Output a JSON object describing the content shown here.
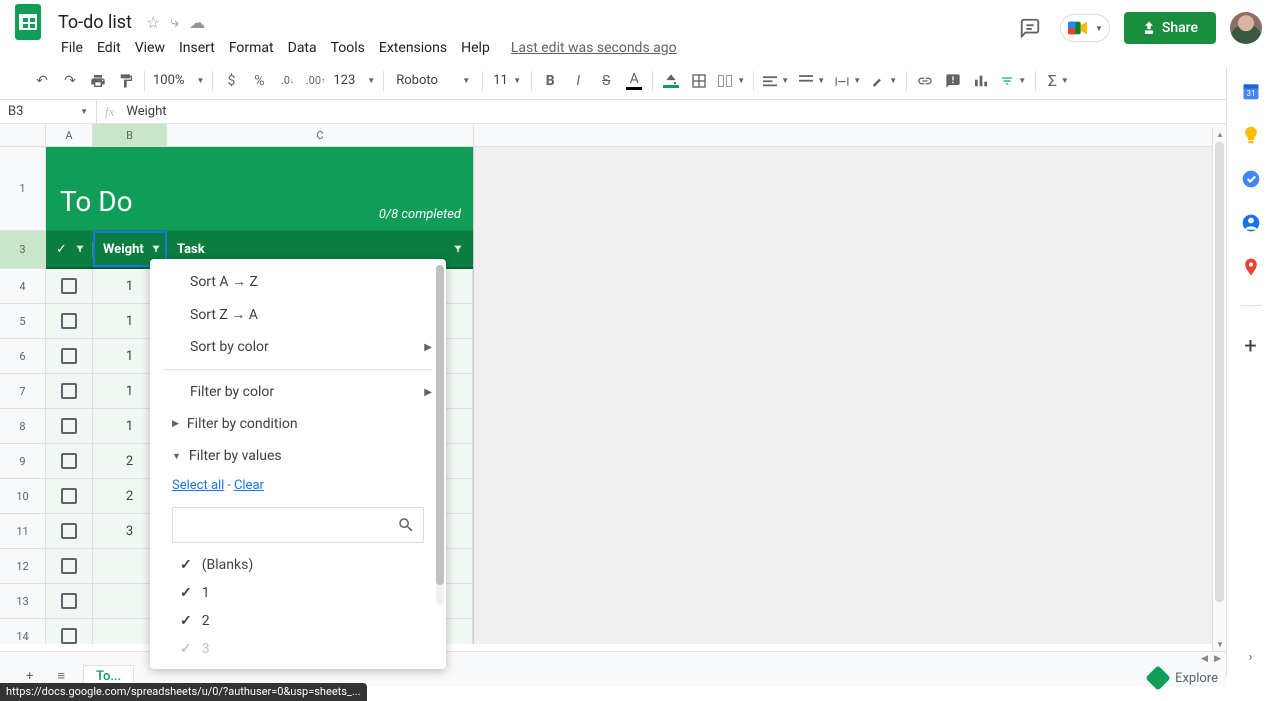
{
  "doc": {
    "title": "To-do list"
  },
  "menu": {
    "file": "File",
    "edit": "Edit",
    "view": "View",
    "insert": "Insert",
    "format": "Format",
    "data": "Data",
    "tools": "Tools",
    "extensions": "Extensions",
    "help": "Help",
    "last_edit": "Last edit was seconds ago"
  },
  "header": {
    "share": "Share"
  },
  "toolbar": {
    "zoom": "100%",
    "font": "Roboto",
    "size": "11",
    "number_format": "123"
  },
  "formula": {
    "name_box": "B3",
    "value": "Weight"
  },
  "columns": {
    "A": "A",
    "B": "B",
    "C": "C"
  },
  "sheet_title": {
    "main": "To Do",
    "completed": "0/8 completed"
  },
  "col_headers": {
    "weight": "Weight",
    "task": "Task"
  },
  "rows": [
    {
      "n": "1"
    },
    {
      "n": "3"
    },
    {
      "n": "4",
      "w": "1"
    },
    {
      "n": "5",
      "w": "1"
    },
    {
      "n": "6",
      "w": "1"
    },
    {
      "n": "7",
      "w": "1"
    },
    {
      "n": "8",
      "w": "1"
    },
    {
      "n": "9",
      "w": "2"
    },
    {
      "n": "10",
      "w": "2"
    },
    {
      "n": "11",
      "w": "3"
    },
    {
      "n": "12"
    },
    {
      "n": "13"
    },
    {
      "n": "14"
    }
  ],
  "filter_popup": {
    "sort_az": "Sort A → Z",
    "sort_za": "Sort Z → A",
    "sort_color": "Sort by color",
    "filter_color": "Filter by color",
    "filter_condition": "Filter by condition",
    "filter_values": "Filter by values",
    "select_all": "Select all",
    "clear": "Clear",
    "values": [
      "(Blanks)",
      "1",
      "2",
      "3"
    ]
  },
  "sheet_tab": "To...",
  "explore": "Explore",
  "status_url": "https://docs.google.com/spreadsheets/u/0/?authuser=0&usp=sheets_..."
}
